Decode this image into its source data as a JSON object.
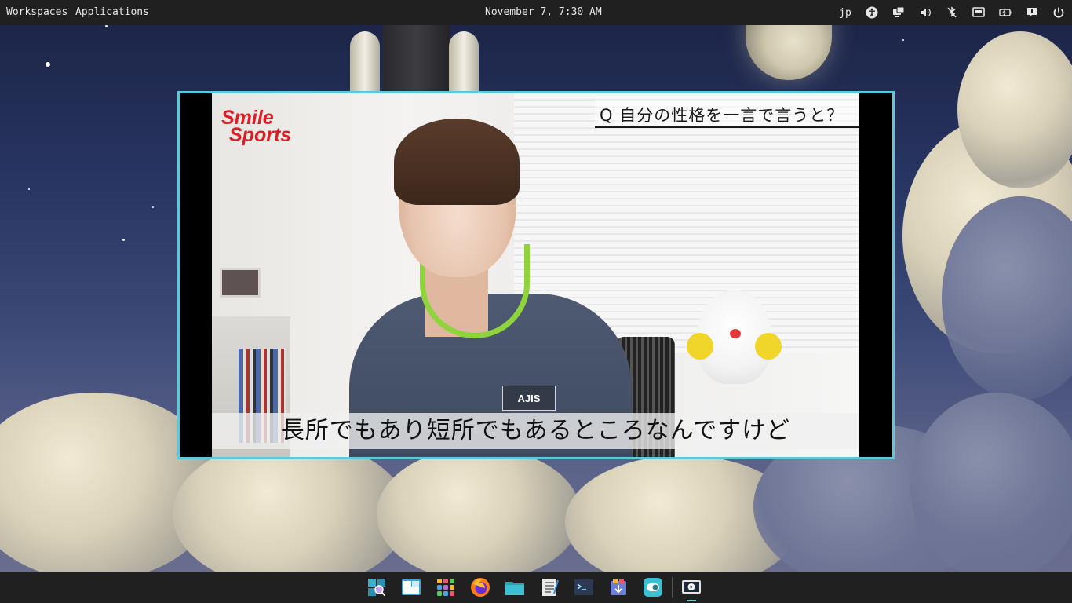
{
  "topbar": {
    "workspaces_label": "Workspaces",
    "applications_label": "Applications",
    "clock": "November 7, 7:30 AM",
    "keyboard_layout": "jp",
    "tray_icons": [
      "accessibility-icon",
      "display-icon",
      "volume-icon",
      "bluetooth-off-icon",
      "network-icon",
      "battery-icon",
      "notifications-icon",
      "power-icon"
    ]
  },
  "video": {
    "logo_line1": "Smile",
    "logo_line2": "Sports",
    "question": "Q 自分の性格を一言で言うと？",
    "subtitle": "長所でもあり短所でもあるところなんですけど",
    "badge_text": "AJIS"
  },
  "dock": {
    "items": [
      "search-app-icon",
      "window-switcher-icon",
      "app-grid-icon",
      "firefox-icon",
      "files-icon",
      "text-editor-icon",
      "terminal-icon",
      "software-store-icon",
      "settings-toggle-icon",
      "video-player-icon"
    ]
  },
  "colors": {
    "window_border": "#5ec8d8",
    "logo_red": "#e01b24",
    "bar_bg": "#202020"
  }
}
